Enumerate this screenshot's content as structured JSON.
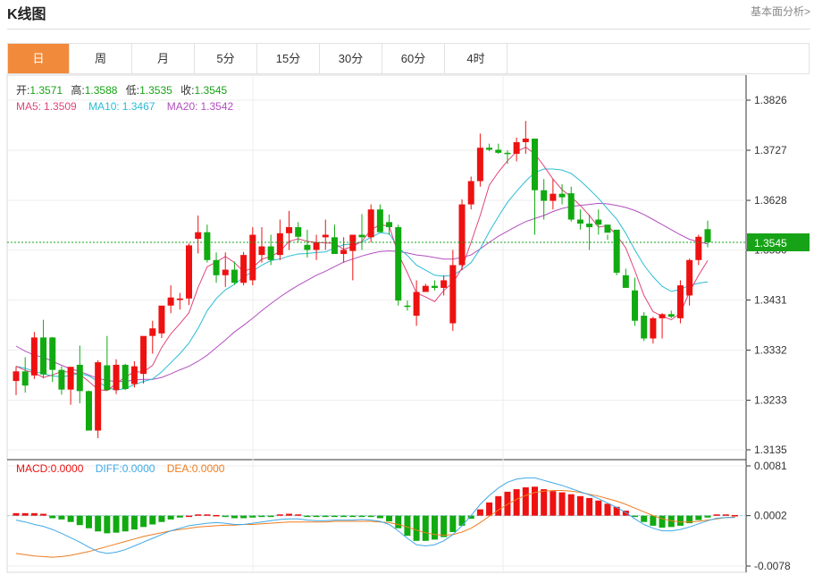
{
  "header": {
    "title": "K线图",
    "link": "基本面分析>"
  },
  "tabs": [
    "日",
    "周",
    "月",
    "5分",
    "15分",
    "30分",
    "60分",
    "4时"
  ],
  "active_tab": 0,
  "info": {
    "open_label": "开:",
    "open": "1.3571",
    "high_label": "高:",
    "high": "1.3588",
    "low_label": "低:",
    "low": "1.3535",
    "close_label": "收:",
    "close": "1.3545",
    "ma5_label": "MA5:",
    "ma5": "1.3509",
    "ma10_label": "MA10:",
    "ma10": "1.3467",
    "ma20_label": "MA20:",
    "ma20": "1.3542"
  },
  "macd_info": {
    "macd_label": "MACD:",
    "macd": "0.0000",
    "diff_label": "DIFF:",
    "diff": "0.0000",
    "dea_label": "DEA:",
    "dea": "0.0000"
  },
  "colors": {
    "up": "#ee1111",
    "down": "#11aa11",
    "ma5": "#e0457b",
    "ma10": "#2bbcd6",
    "ma20": "#b24fbf",
    "diff": "#3fa9e8",
    "dea": "#ef7d20",
    "current": "#17a317",
    "tab_active": "#f28a3b"
  },
  "chart_data": [
    {
      "type": "candlestick",
      "y_ticks": [
        "1.3826",
        "1.3727",
        "1.3628",
        "1.3530",
        "1.3431",
        "1.3332",
        "1.3233",
        "1.3135"
      ],
      "y_tick_values": [
        1.3826,
        1.3727,
        1.3628,
        1.353,
        1.3431,
        1.3332,
        1.3233,
        1.3135
      ],
      "ylim": [
        1.3135,
        1.3826
      ],
      "current_price_label": "1.3545",
      "current_price": 1.3545,
      "candles": [
        [
          1.3271,
          1.33,
          1.3243,
          1.329
        ],
        [
          1.329,
          1.3318,
          1.3248,
          1.3262
        ],
        [
          1.3282,
          1.3368,
          1.3275,
          1.3357
        ],
        [
          1.3357,
          1.3392,
          1.3276,
          1.3284
        ],
        [
          1.3357,
          1.3358,
          1.3269,
          1.3293
        ],
        [
          1.3293,
          1.33,
          1.3244,
          1.3254
        ],
        [
          1.3254,
          1.3286,
          1.3224,
          1.3299
        ],
        [
          1.3303,
          1.3341,
          1.3227,
          1.3251
        ],
        [
          1.3251,
          1.3252,
          1.3176,
          1.3173
        ],
        [
          1.3173,
          1.3312,
          1.3158,
          1.3308
        ],
        [
          1.3302,
          1.336,
          1.3252,
          1.3253
        ],
        [
          1.3253,
          1.3314,
          1.3245,
          1.3303
        ],
        [
          1.3303,
          1.3305,
          1.3253,
          1.3255
        ],
        [
          1.3265,
          1.331,
          1.3258,
          1.33
        ],
        [
          1.3285,
          1.3355,
          1.3266,
          1.336
        ],
        [
          1.336,
          1.339,
          1.3325,
          1.3375
        ],
        [
          1.3365,
          1.3412,
          1.3356,
          1.342
        ],
        [
          1.342,
          1.346,
          1.3405,
          1.3436
        ],
        [
          1.3431,
          1.3445,
          1.3412,
          1.3434
        ],
        [
          1.3434,
          1.3543,
          1.3421,
          1.3539
        ],
        [
          1.3552,
          1.3598,
          1.3523,
          1.3565
        ],
        [
          1.3565,
          1.358,
          1.3505,
          1.351
        ],
        [
          1.351,
          1.3525,
          1.3465,
          1.348
        ],
        [
          1.348,
          1.3525,
          1.3457,
          1.3491
        ],
        [
          1.3491,
          1.3507,
          1.3461,
          1.3465
        ],
        [
          1.3465,
          1.3526,
          1.346,
          1.352
        ],
        [
          1.347,
          1.3575,
          1.346,
          1.356
        ],
        [
          1.352,
          1.3575,
          1.3505,
          1.3537
        ],
        [
          1.3537,
          1.356,
          1.35,
          1.351
        ],
        [
          1.352,
          1.359,
          1.351,
          1.3563
        ],
        [
          1.3563,
          1.3607,
          1.353,
          1.3575
        ],
        [
          1.3575,
          1.3585,
          1.3545,
          1.3556
        ],
        [
          1.354,
          1.357,
          1.3515,
          1.353
        ],
        [
          1.353,
          1.356,
          1.351,
          1.3545
        ],
        [
          1.3555,
          1.359,
          1.353,
          1.356
        ],
        [
          1.3555,
          1.358,
          1.3525,
          1.3522
        ],
        [
          1.3522,
          1.3555,
          1.3505,
          1.353
        ],
        [
          1.3528,
          1.3555,
          1.347,
          1.356
        ],
        [
          1.356,
          1.3601,
          1.353,
          1.3555
        ],
        [
          1.3555,
          1.362,
          1.3545,
          1.361
        ],
        [
          1.361,
          1.362,
          1.357,
          1.3565
        ],
        [
          1.3585,
          1.36,
          1.356,
          1.3575
        ],
        [
          1.3575,
          1.358,
          1.342,
          1.343
        ],
        [
          1.342,
          1.343,
          1.341,
          1.3418
        ],
        [
          1.34,
          1.347,
          1.338,
          1.3447
        ],
        [
          1.3447,
          1.3463,
          1.3447,
          1.3459
        ],
        [
          1.3459,
          1.347,
          1.345,
          1.3455
        ],
        [
          1.3455,
          1.348,
          1.344,
          1.347
        ],
        [
          1.3385,
          1.353,
          1.337,
          1.35
        ],
        [
          1.35,
          1.363,
          1.349,
          1.362
        ],
        [
          1.362,
          1.3675,
          1.361,
          1.3666
        ],
        [
          1.3666,
          1.376,
          1.3655,
          1.3732
        ],
        [
          1.3732,
          1.374,
          1.3725,
          1.3728
        ],
        [
          1.3728,
          1.374,
          1.372,
          1.3722
        ],
        [
          1.3722,
          1.3727,
          1.37,
          1.372
        ],
        [
          1.372,
          1.3752,
          1.3705,
          1.3743
        ],
        [
          1.3743,
          1.3785,
          1.372,
          1.375
        ],
        [
          1.375,
          1.374,
          1.356,
          1.3648
        ],
        [
          1.3648,
          1.367,
          1.359,
          1.3627
        ],
        [
          1.3627,
          1.367,
          1.361,
          1.3641
        ],
        [
          1.3641,
          1.366,
          1.362,
          1.3634
        ],
        [
          1.3642,
          1.3655,
          1.3586,
          1.359
        ],
        [
          1.359,
          1.361,
          1.357,
          1.3582
        ],
        [
          1.3582,
          1.36,
          1.353,
          1.3575
        ],
        [
          1.359,
          1.361,
          1.356,
          1.358
        ],
        [
          1.358,
          1.356,
          1.355,
          1.3564
        ],
        [
          1.357,
          1.356,
          1.348,
          1.3485
        ],
        [
          1.348,
          1.3493,
          1.346,
          1.3455
        ],
        [
          1.345,
          1.3475,
          1.338,
          1.339
        ],
        [
          1.34,
          1.3407,
          1.335,
          1.3355
        ],
        [
          1.3355,
          1.3398,
          1.3345,
          1.3395
        ],
        [
          1.3395,
          1.3405,
          1.3355,
          1.3403
        ],
        [
          1.3403,
          1.341,
          1.3395,
          1.3398
        ],
        [
          1.3395,
          1.347,
          1.3385,
          1.346
        ],
        [
          1.344,
          1.3513,
          1.342,
          1.351
        ],
        [
          1.351,
          1.356,
          1.35,
          1.3556
        ],
        [
          1.3571,
          1.3588,
          1.3535,
          1.3545
        ]
      ],
      "ma5": [
        1.33,
        1.3292,
        1.3287,
        1.3278,
        1.3283,
        1.329,
        1.3288,
        1.3284,
        1.327,
        1.3254,
        1.3252,
        1.3266,
        1.3279,
        1.3289,
        1.3289,
        1.3302,
        1.3337,
        1.3364,
        1.3384,
        1.3406,
        1.3456,
        1.3497,
        1.3506,
        1.3517,
        1.3505,
        1.3487,
        1.3495,
        1.3512,
        1.3517,
        1.3527,
        1.3547,
        1.3552,
        1.3547,
        1.3545,
        1.3544,
        1.3543,
        1.3531,
        1.3537,
        1.3547,
        1.357,
        1.358,
        1.3577,
        1.3522,
        1.3485,
        1.3445,
        1.3437,
        1.3428,
        1.345,
        1.3465,
        1.3494,
        1.3545,
        1.3598,
        1.3658,
        1.3684,
        1.3706,
        1.3724,
        1.3733,
        1.372,
        1.3696,
        1.367,
        1.3649,
        1.3635,
        1.3618,
        1.3598,
        1.3575,
        1.3578,
        1.3559,
        1.3534,
        1.3489,
        1.344,
        1.3408,
        1.3399,
        1.3392,
        1.3405,
        1.3447,
        1.348,
        1.3509
      ],
      "ma10": [
        1.33,
        1.3296,
        1.329,
        1.3285,
        1.3281,
        1.3279,
        1.3282,
        1.3286,
        1.3281,
        1.327,
        1.3258,
        1.3253,
        1.3256,
        1.3264,
        1.327,
        1.3275,
        1.3289,
        1.3307,
        1.3325,
        1.3346,
        1.3375,
        1.341,
        1.3434,
        1.3451,
        1.3462,
        1.3476,
        1.3488,
        1.35,
        1.3509,
        1.3512,
        1.3518,
        1.3522,
        1.3523,
        1.3525,
        1.3526,
        1.3534,
        1.354,
        1.3542,
        1.3545,
        1.3555,
        1.3564,
        1.3562,
        1.3535,
        1.3519,
        1.35,
        1.349,
        1.348,
        1.3478,
        1.348,
        1.3491,
        1.3505,
        1.3532,
        1.3566,
        1.3596,
        1.3624,
        1.3646,
        1.3666,
        1.3683,
        1.369,
        1.369,
        1.3688,
        1.3681,
        1.3667,
        1.365,
        1.3632,
        1.3611,
        1.3591,
        1.3563,
        1.353,
        1.35,
        1.3477,
        1.3458,
        1.3448,
        1.3452,
        1.346,
        1.3464,
        1.3467
      ],
      "ma20": [
        1.334,
        1.333,
        1.3322,
        1.3318,
        1.331,
        1.3302,
        1.3295,
        1.329,
        1.3283,
        1.3276,
        1.3272,
        1.327,
        1.327,
        1.3273,
        1.3274,
        1.3274,
        1.3278,
        1.3285,
        1.3293,
        1.33,
        1.331,
        1.3322,
        1.3337,
        1.3352,
        1.3368,
        1.3381,
        1.3395,
        1.341,
        1.3424,
        1.3437,
        1.3449,
        1.346,
        1.347,
        1.348,
        1.3488,
        1.3497,
        1.3506,
        1.3512,
        1.3518,
        1.3523,
        1.3527,
        1.3528,
        1.3527,
        1.3524,
        1.352,
        1.3518,
        1.3515,
        1.3512,
        1.3512,
        1.3515,
        1.352,
        1.3532,
        1.3545,
        1.3557,
        1.3567,
        1.3577,
        1.3586,
        1.3592,
        1.3598,
        1.3606,
        1.3612,
        1.3616,
        1.3618,
        1.362,
        1.3622,
        1.3621,
        1.3618,
        1.3614,
        1.3608,
        1.36,
        1.359,
        1.358,
        1.357,
        1.356,
        1.3551,
        1.3546,
        1.3542
      ]
    },
    {
      "type": "macd",
      "y_ticks": [
        "0.0081",
        "0.0002",
        "-0.0078"
      ],
      "y_tick_values": [
        0.0081,
        0.0002,
        -0.0078
      ],
      "ylim": [
        -0.0078,
        0.0081
      ],
      "hist": [
        0.0004,
        0.0004,
        0.0004,
        0.0003,
        -0.0004,
        -0.0006,
        -0.001,
        -0.0015,
        -0.002,
        -0.0025,
        -0.0028,
        -0.0027,
        -0.0025,
        -0.0022,
        -0.0018,
        -0.0014,
        -0.001,
        -0.0006,
        -0.0003,
        0.0,
        0.0002,
        0.0002,
        0.0001,
        -0.0002,
        -0.0004,
        -0.0004,
        -0.0003,
        -0.0002,
        -0.0001,
        0.0002,
        0.0003,
        0.0002,
        -0.0001,
        -0.0002,
        -0.0002,
        -0.0001,
        -0.0002,
        -0.0002,
        -0.0001,
        -0.0002,
        -0.0004,
        -0.0009,
        -0.002,
        -0.0032,
        -0.004,
        -0.004,
        -0.0038,
        -0.0034,
        -0.0026,
        -0.0016,
        -0.0005,
        0.001,
        0.0021,
        0.0031,
        0.0038,
        0.0042,
        0.0045,
        0.0046,
        0.0042,
        0.0039,
        0.0037,
        0.0034,
        0.0031,
        0.0028,
        0.0024,
        0.0019,
        0.0014,
        0.0008,
        -0.0002,
        -0.001,
        -0.0016,
        -0.0019,
        -0.0018,
        -0.0016,
        -0.0012,
        -0.0007,
        -0.0003,
        0.0002,
        0.0002,
        0.0001
      ],
      "diff": [
        -0.0005,
        -0.0008,
        -0.0012,
        -0.0015,
        -0.002,
        -0.0026,
        -0.0033,
        -0.004,
        -0.0048,
        -0.0055,
        -0.0058,
        -0.0056,
        -0.0052,
        -0.0046,
        -0.004,
        -0.0034,
        -0.0028,
        -0.0022,
        -0.0018,
        -0.0014,
        -0.0012,
        -0.001,
        -0.0009,
        -0.001,
        -0.0012,
        -0.0012,
        -0.001,
        -0.0008,
        -0.0006,
        -0.0004,
        -0.0003,
        -0.0003,
        -0.0005,
        -0.0006,
        -0.0006,
        -0.0005,
        -0.0005,
        -0.0005,
        -0.0004,
        -0.0005,
        -0.0007,
        -0.0012,
        -0.0022,
        -0.0034,
        -0.0044,
        -0.0046,
        -0.0044,
        -0.0038,
        -0.0028,
        -0.0014,
        0.0002,
        0.002,
        0.0034,
        0.0046,
        0.0055,
        0.006,
        0.0062,
        0.0062,
        0.0058,
        0.0054,
        0.005,
        0.0045,
        0.004,
        0.0035,
        0.0029,
        0.0022,
        0.0015,
        0.0007,
        -0.0003,
        -0.0012,
        -0.0018,
        -0.0022,
        -0.0022,
        -0.002,
        -0.0016,
        -0.0011,
        -0.0006,
        -0.0002,
        -0.0001,
        -0.0001
      ],
      "dea": [
        -0.0058,
        -0.006,
        -0.0062,
        -0.0063,
        -0.0064,
        -0.0063,
        -0.0061,
        -0.0058,
        -0.0055,
        -0.0051,
        -0.0047,
        -0.0043,
        -0.0039,
        -0.0035,
        -0.0031,
        -0.0028,
        -0.0025,
        -0.0022,
        -0.002,
        -0.0018,
        -0.0016,
        -0.0015,
        -0.0014,
        -0.0013,
        -0.0013,
        -0.0012,
        -0.0012,
        -0.0011,
        -0.001,
        -0.0009,
        -0.0008,
        -0.0008,
        -0.0008,
        -0.0008,
        -0.0008,
        -0.0007,
        -0.0007,
        -0.0007,
        -0.0007,
        -0.0007,
        -0.0008,
        -0.0009,
        -0.0012,
        -0.0016,
        -0.0021,
        -0.0025,
        -0.0028,
        -0.0029,
        -0.0028,
        -0.0024,
        -0.0018,
        -0.0009,
        0.0001,
        0.0011,
        0.002,
        0.0028,
        0.0034,
        0.0039,
        0.0041,
        0.0042,
        0.0042,
        0.0041,
        0.0039,
        0.0036,
        0.0033,
        0.0029,
        0.0025,
        0.002,
        0.0014,
        0.0008,
        0.0002,
        -0.0003,
        -0.0006,
        -0.0008,
        -0.0008,
        -0.0007,
        -0.0005,
        -0.0003,
        -0.0001,
        0.0
      ]
    }
  ]
}
